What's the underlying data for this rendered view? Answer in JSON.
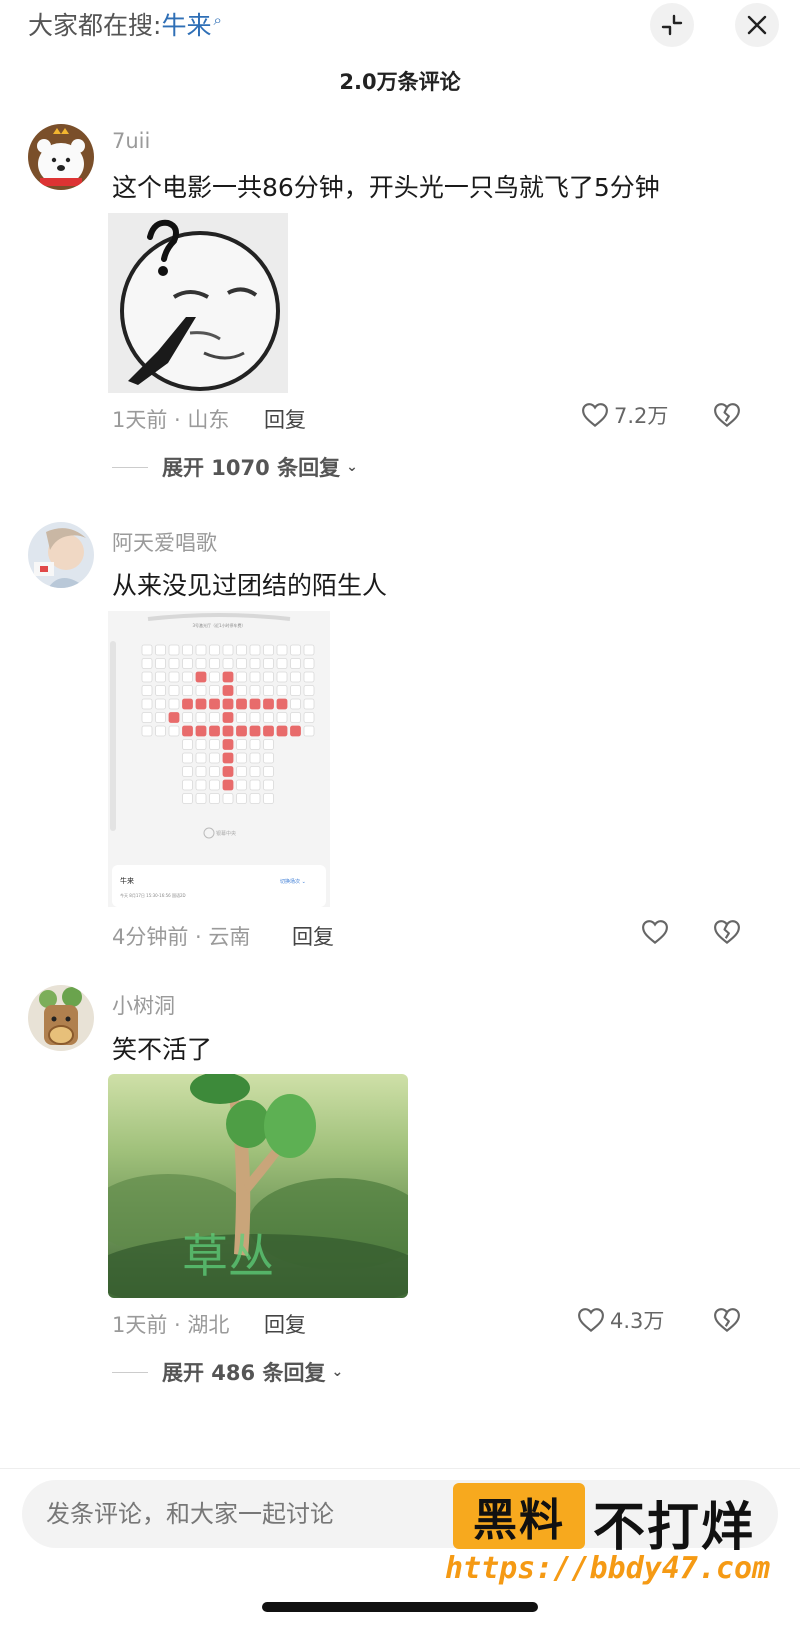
{
  "header": {
    "search_prefix": "大家都在搜:",
    "search_term": "牛来",
    "comment_count": "2.0万条评论"
  },
  "icons": {
    "search": "search-icon",
    "collapse": "collapse-icon",
    "close": "close-icon",
    "heart": "heart-icon",
    "dislike": "broken-heart-icon"
  },
  "comments": [
    {
      "username": "7uii",
      "text": "这个电影一共86分钟，开头光一只鸟就飞了5分钟",
      "meta": "1天前 · 山东",
      "reply": "回复",
      "likes": "7.2万",
      "expand": "展开 1070 条回复"
    },
    {
      "username": "阿天爱唱歌",
      "text": "从来没见过团结的陌生人",
      "meta": "4分钟前 · 云南",
      "reply": "回复",
      "likes": "",
      "cinema": {
        "hall": "3号激光厅（近1小时停车费）",
        "screen_label": "银幕中央",
        "movie": "牛来",
        "showtime": "今天 8月17日 15:30-16:56 国语2D",
        "link": "切换场次 ⌄"
      }
    },
    {
      "username": "小树洞",
      "text": "笑不活了",
      "meta": "1天前 · 湖北",
      "reply": "回复",
      "likes": "4.3万",
      "expand": "展开 486 条回复",
      "image_caption": "草丛"
    }
  ],
  "footer": {
    "input_placeholder": "发条评论，和大家一起讨论"
  },
  "watermark": {
    "badge": "黑料",
    "side": "不打烊",
    "url": "https://bbdy47.com"
  },
  "colors": {
    "search_term": "#2f6fb6",
    "seat_selected": "#e86b6b",
    "watermark_orange": "#f7a91e"
  }
}
